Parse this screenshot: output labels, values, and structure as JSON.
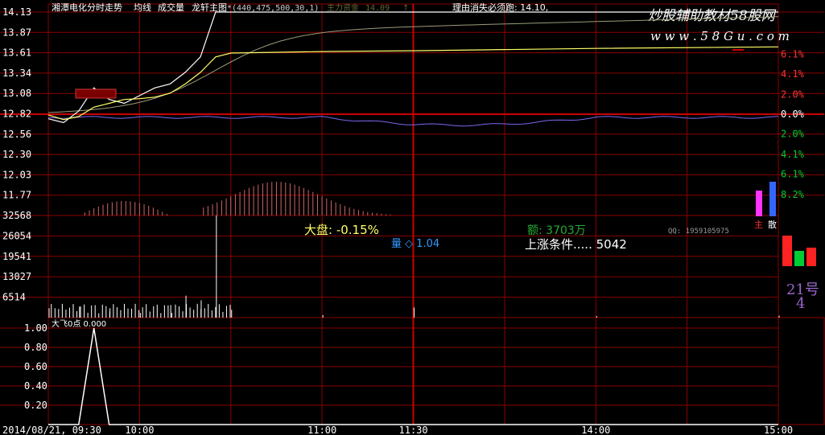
{
  "header": {
    "stock_chart_title": "湘潭电化分时走势",
    "avg_label": "均线",
    "volume_label": "成交量",
    "indicator_label": "龙轩主图",
    "params": "*(440,475,500,30,1)",
    "main_fund_label": "主力资金",
    "main_fund_value": "14.09",
    "reason_text": "理由消失必须跑: 14.10,"
  },
  "watermark": {
    "line1": "炒股辅助教材58股网",
    "line2": "w w w . 5 8 G u . c o m"
  },
  "price_axis": {
    "labels": [
      "14.13",
      "13.87",
      "13.61",
      "13.34",
      "13.08",
      "12.82",
      "12.56",
      "12.30",
      "12.03",
      "11.77"
    ],
    "values": [
      14.13,
      13.87,
      13.61,
      13.34,
      13.08,
      12.82,
      12.56,
      12.3,
      12.03,
      11.77
    ]
  },
  "pct_axis": {
    "labels": [
      "6.1%",
      "4.1%",
      "2.0%",
      "0.0%",
      "2.0%",
      "4.1%",
      "6.1%",
      "8.2%"
    ],
    "values": [
      6.1,
      4.1,
      2.0,
      0.0,
      -2.0,
      -4.1,
      -6.1,
      -8.2
    ]
  },
  "volume_axis": {
    "labels": [
      "32568",
      "26054",
      "19541",
      "13027",
      "6514"
    ],
    "values": [
      32568,
      26054,
      19541,
      13027,
      6514
    ]
  },
  "sub_axis": {
    "labels": [
      "1.00",
      "0.80",
      "0.60",
      "0.40",
      "0.20"
    ],
    "values": [
      1.0,
      0.8,
      0.6,
      0.4,
      0.2
    ]
  },
  "time_axis": {
    "start_label": "2014/08/21, 09:30",
    "labels": [
      "10:00",
      "11:00",
      "11:30",
      "14:00",
      "15:00"
    ]
  },
  "info": {
    "market_text": "大盘: -0.15%",
    "qty_text": "量 ◇ 1.04",
    "amount_text": "额: 3703万",
    "qq_text": "QQ: 1959105975",
    "condition_text": "上涨条件.....  5042",
    "number_21": "21号",
    "number_4": "4",
    "main_label": "主",
    "scatter_label": "散"
  },
  "subchart": {
    "title": "大飞0点 0.000"
  },
  "colors": {
    "grid": "#8b0000",
    "price_line": "#ffffff",
    "avg_line": "#ffff66",
    "indicator_line": "#9b9b7a",
    "purple_line": "#7b68ee",
    "up": "#ff3333",
    "down": "#00cc33",
    "magenta": "#ff33ff",
    "blue": "#3366ff"
  },
  "chart_data": [
    {
      "type": "line",
      "name": "price",
      "ylim": [
        11.77,
        14.13
      ],
      "x": [
        "09:30",
        "09:35",
        "09:40",
        "09:45",
        "09:50",
        "09:55",
        "10:00",
        "10:05",
        "10:10",
        "10:15",
        "10:20",
        "10:25",
        "10:30",
        "11:00",
        "11:30",
        "14:00",
        "15:00"
      ],
      "series": [
        {
          "values": [
            12.75,
            12.7,
            12.85,
            13.15,
            13.0,
            12.95,
            13.05,
            13.15,
            13.2,
            13.35,
            13.55,
            14.13,
            14.13,
            14.13,
            14.13,
            14.13,
            14.13
          ]
        },
        {
          "values": [
            12.8,
            12.74,
            12.78,
            12.9,
            12.95,
            13.0,
            13.01,
            13.03,
            13.08,
            13.2,
            13.35,
            13.55,
            13.6,
            13.62,
            13.63,
            13.66,
            13.68
          ]
        }
      ]
    },
    {
      "type": "bar",
      "name": "volume",
      "ylim": [
        0,
        32568
      ],
      "x": [
        "09:30",
        "09:40",
        "09:50",
        "10:00",
        "10:10",
        "10:15",
        "10:20",
        "10:25",
        "10:30",
        "11:00",
        "11:30",
        "14:00",
        "15:00"
      ],
      "values": [
        3000,
        3500,
        3000,
        1500,
        4000,
        7000,
        5500,
        32568,
        2500,
        800,
        3200,
        500,
        600
      ]
    },
    {
      "type": "line",
      "name": "sub",
      "ylim": [
        0,
        1.0
      ],
      "x": [
        "09:30",
        "09:40",
        "09:45",
        "09:50",
        "10:00",
        "15:00"
      ],
      "values": [
        0,
        0,
        1.0,
        0,
        0,
        0
      ]
    }
  ]
}
